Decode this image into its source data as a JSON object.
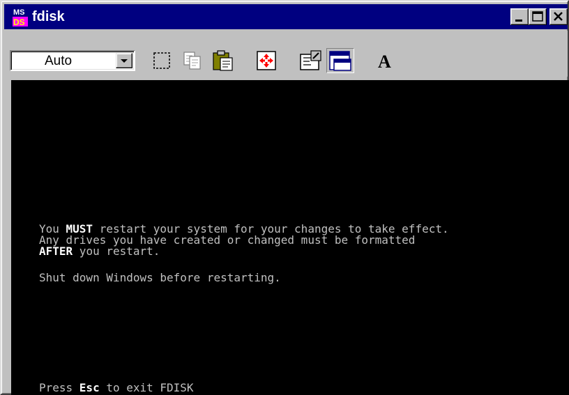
{
  "window": {
    "title": "fdisk",
    "app_icon": "ms-dos-icon",
    "caption_buttons": [
      "minimize-icon",
      "maximize-icon",
      "close-icon"
    ]
  },
  "toolbar": {
    "font_size_value": "Auto",
    "buttons": [
      {
        "name": "mark",
        "icon": "mark-icon"
      },
      {
        "name": "copy",
        "icon": "copy-icon"
      },
      {
        "name": "paste",
        "icon": "paste-icon"
      },
      {
        "name": "full-screen",
        "icon": "full-screen-icon"
      },
      {
        "name": "properties",
        "icon": "properties-icon"
      },
      {
        "name": "background",
        "icon": "background-icon"
      },
      {
        "name": "font",
        "icon": "font-icon",
        "label": "A"
      }
    ]
  },
  "console": {
    "line1": {
      "pre": "You ",
      "em": "MUST",
      "post": " restart your system for your changes to take effect."
    },
    "line2": "Any drives you have created or changed must be formatted",
    "line3": {
      "em": "AFTER",
      "post": " you restart."
    },
    "line4": "Shut down Windows before restarting.",
    "footer": {
      "pre": "Press ",
      "em": "Esc",
      "post": " to exit FDISK"
    }
  },
  "colors": {
    "titlebar": "#000080",
    "console_bg": "#000000",
    "console_text": "#c0c0c0",
    "console_bright": "#ffffff",
    "chrome": "#c0c0c0"
  }
}
